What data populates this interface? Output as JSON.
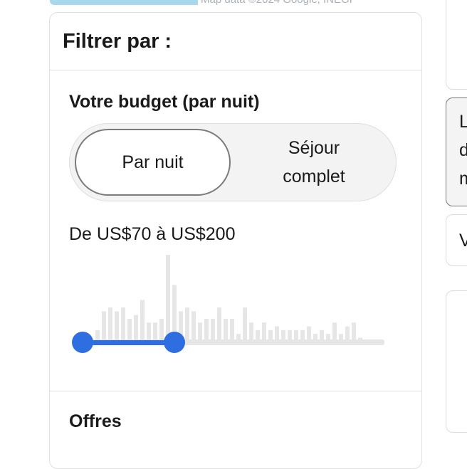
{
  "top_strip": {
    "map_text": "Map data ©2024 Google, INEGI"
  },
  "filter": {
    "title": "Filtrer par :",
    "budget": {
      "title": "Votre budget (par nuit)",
      "toggle": {
        "options": [
          "Par nuit",
          "Séjour\ncomplet"
        ],
        "selected": "Par nuit"
      },
      "range_text": "De US$70 à US$200",
      "min_value": 70,
      "max_value": 200,
      "histogram_heights": [
        4,
        9,
        10,
        9,
        10,
        7,
        8,
        12,
        6,
        6,
        7,
        24,
        16,
        9,
        10,
        9,
        6,
        7,
        7,
        10,
        7,
        7,
        3,
        10,
        6,
        4,
        6,
        4,
        5,
        4,
        4,
        4,
        4,
        5,
        3,
        4,
        3,
        6,
        3,
        5,
        6,
        2
      ]
    },
    "offers_title": "Offres"
  },
  "side": {
    "card2_text": "L\nd\nm",
    "card3_text": "V"
  },
  "colors": {
    "accent": "#2f6ee0",
    "bar": "#e6e6e6",
    "border": "#e0e0e0"
  }
}
